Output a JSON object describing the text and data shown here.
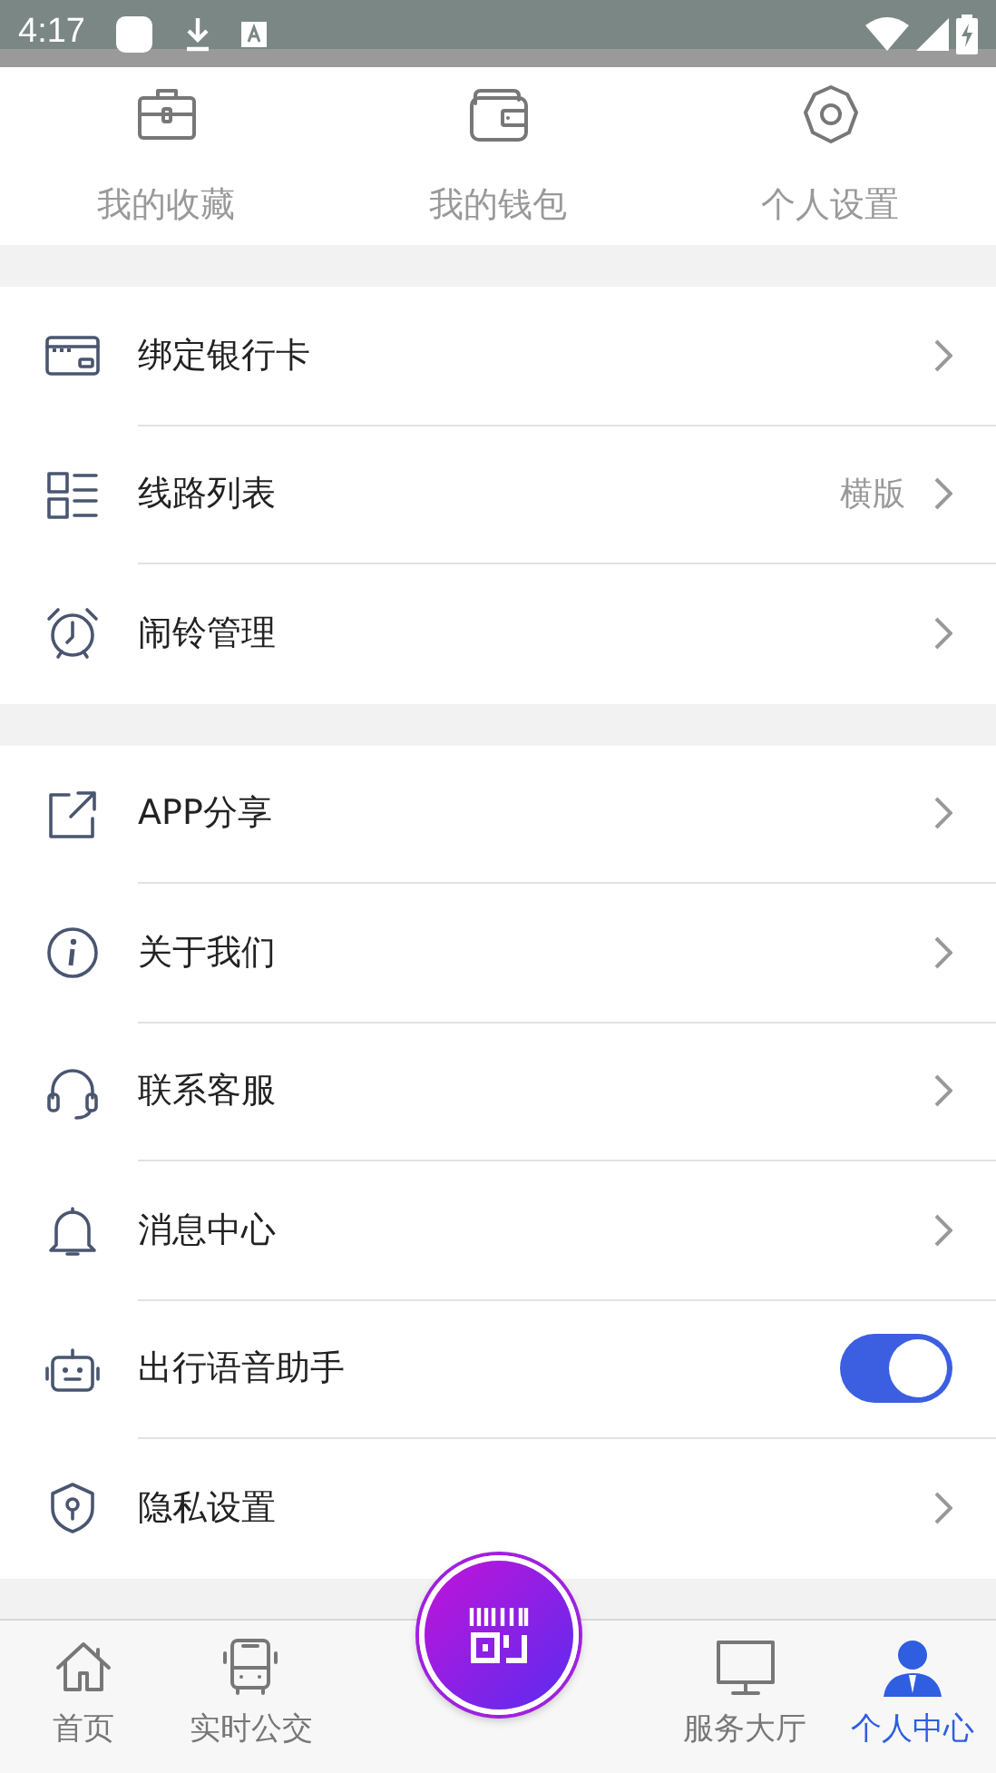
{
  "status_bar": {
    "time": "4:17"
  },
  "quick_actions": [
    {
      "label": "我的收藏"
    },
    {
      "label": "我的钱包"
    },
    {
      "label": "个人设置"
    }
  ],
  "groups": [
    {
      "rows": [
        {
          "label": "绑定银行卡",
          "kind": "chevron"
        },
        {
          "label": "线路列表",
          "value": "横版",
          "kind": "chevron"
        },
        {
          "label": "闹铃管理",
          "kind": "chevron"
        }
      ]
    },
    {
      "rows": [
        {
          "label": "APP分享",
          "kind": "chevron"
        },
        {
          "label": "关于我们",
          "kind": "chevron"
        },
        {
          "label": "联系客服",
          "kind": "chevron"
        },
        {
          "label": "消息中心",
          "kind": "chevron"
        },
        {
          "label": "出行语音助手",
          "kind": "switch",
          "on": true
        },
        {
          "label": "隐私设置",
          "kind": "chevron"
        }
      ]
    }
  ],
  "tab_bar": [
    {
      "label": "首页",
      "selected": false
    },
    {
      "label": "实时公交",
      "selected": false
    },
    {
      "kind": "scan"
    },
    {
      "label": "服务大厅",
      "selected": false
    },
    {
      "label": "个人中心",
      "selected": true
    }
  ]
}
